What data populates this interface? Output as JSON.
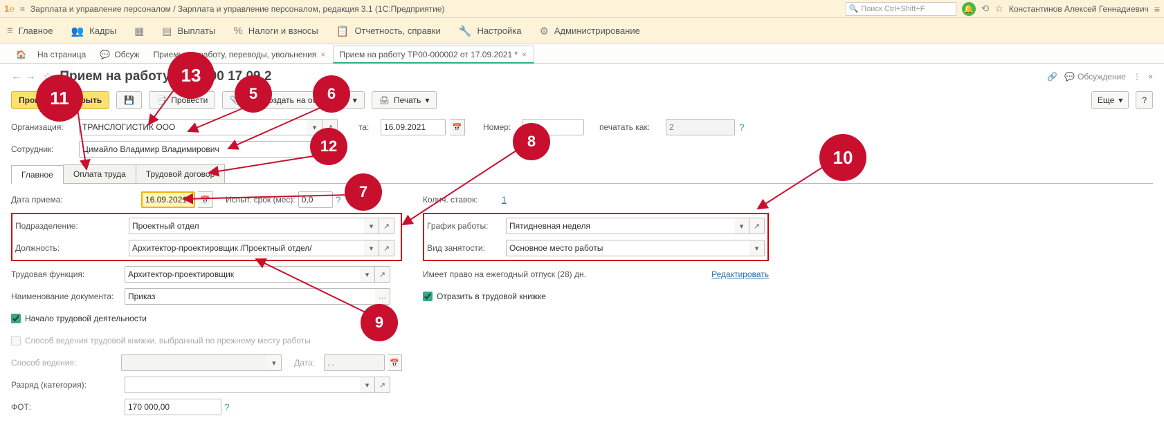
{
  "titlebar": {
    "app_title": "Зарплата и управление персоналом / Зарплата и управление персоналом, редакция 3.1  (1С:Предприятие)",
    "search_placeholder": "Поиск Ctrl+Shift+F",
    "user_name": "Константинов Алексей Геннадиевич"
  },
  "mainmenu": {
    "items": [
      {
        "icon": "≡",
        "label": "Главное"
      },
      {
        "icon": "👥",
        "label": "Кадры"
      },
      {
        "icon": "🧮",
        "label": ""
      },
      {
        "icon": "💰",
        "label": "Выплаты"
      },
      {
        "icon": "%",
        "label": "Налоги и взносы"
      },
      {
        "icon": "📋",
        "label": "Отчетность, справки"
      },
      {
        "icon": "🔧",
        "label": "Настройка"
      },
      {
        "icon": "⚙",
        "label": "Администрирование"
      }
    ]
  },
  "tabs": {
    "t0": "На             страница",
    "t1": "Обсуж",
    "t2": "Приемы на работу, переводы, увольнения",
    "t3": "Прием на работу ТР00-000002 от 17.09.2021 *"
  },
  "form": {
    "title": "Прием на работу ТР00-00          17.09.2",
    "discuss": "Обсуждение"
  },
  "toolbar": {
    "post_close": "Провести и закрыть",
    "post": "Провести",
    "create_based": "Создать на основании",
    "print": "Печать",
    "more": "Еще"
  },
  "fields": {
    "org_label": "Организация:",
    "org_value": "ТРАНСЛОГИСТИК ООО",
    "date_label": "та:",
    "date_value": "16.09.2021",
    "num_label": "Номер:",
    "num_value": "02",
    "print_as_label": "печатать как:",
    "print_as_value": "2",
    "emp_label": "Сотрудник:",
    "emp_value": "Цимайло Владимир Владимирович"
  },
  "subtabs": {
    "t0": "Главное",
    "t1": "Оплата труда",
    "t2": "Трудовой договор"
  },
  "body": {
    "hire_date_label": "Дата приема:",
    "hire_date_value": "16.09.2021",
    "probation_label": "Испыт. срок (мес):",
    "probation_value": "0,0",
    "dept_label": "Подразделение:",
    "dept_value": "Проектный отдел",
    "position_label": "Должность:",
    "position_value": "Архитектор-проектировщик /Проектный отдел/",
    "func_label": "Трудовая функция:",
    "func_value": "Архитектор-проектировщик",
    "docname_label": "Наименование документа:",
    "docname_value": "Приказ",
    "start_chk": "Начало трудовой деятельности",
    "method_prev": "Способ ведения трудовой книжки, выбранный по прежнему месту работы",
    "method_label": "Способ ведения:",
    "method_date_label": "Дата:",
    "method_date_value": ".  .",
    "rank_label": "Разряд (категория):",
    "fot_label": "ФОТ:",
    "fot_value": "170 000,00",
    "rates_label": "Колич. ставок:",
    "rates_value": "1",
    "sched_label": "График работы:",
    "sched_value": "Пятидневная неделя",
    "emptype_label": "Вид занятости:",
    "emptype_value": "Основное место работы",
    "vacation_text": "Имеет право на ежегодный отпуск (28) дн.",
    "edit_link": "Редактировать",
    "reflect_chk": "Отразить в трудовой книжке"
  }
}
